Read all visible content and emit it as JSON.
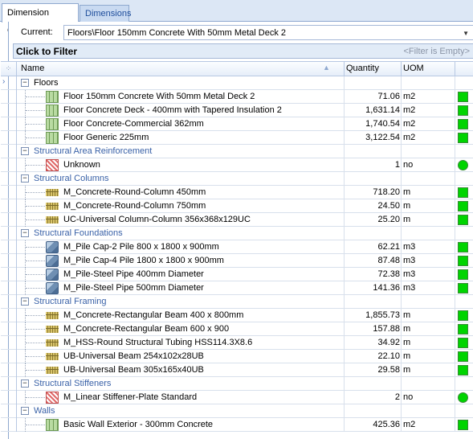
{
  "tabs": [
    "Dimension Groups",
    "Dimensions"
  ],
  "current": {
    "label": "Current:",
    "value": "Floors\\Floor 150mm Concrete With 50mm Metal Deck 2"
  },
  "filter": {
    "title": "Click to Filter",
    "empty_text": "<Filter is Empty>"
  },
  "columns": {
    "name": "Name",
    "quantity": "Quantity",
    "uom": "UOM"
  },
  "colors": {
    "status_green": "#00d400",
    "group_text": "#3a62a8",
    "tab_bg": "#dce7f5"
  },
  "rows": [
    {
      "type": "group",
      "label": "Floors",
      "first": true
    },
    {
      "type": "item",
      "icon": "floor-grid-icon",
      "name": "Floor 150mm Concrete With 50mm Metal Deck 2",
      "qty": "71.06",
      "uom": "m2",
      "status": "square"
    },
    {
      "type": "item",
      "icon": "floor-grid-icon",
      "name": "Floor Concrete Deck - 400mm with Tapered Insulation 2",
      "qty": "1,631.14",
      "uom": "m2",
      "status": "square"
    },
    {
      "type": "item",
      "icon": "floor-grid-icon",
      "name": "Floor Concrete-Commercial 362mm",
      "qty": "1,740.54",
      "uom": "m2",
      "status": "square"
    },
    {
      "type": "item",
      "icon": "floor-grid-icon",
      "name": "Floor Generic 225mm",
      "qty": "3,122.54",
      "uom": "m2",
      "status": "square"
    },
    {
      "type": "group",
      "label": "Structural Area Reinforcement"
    },
    {
      "type": "item",
      "icon": "rebar-icon",
      "name": "Unknown",
      "qty": "1",
      "uom": "no",
      "status": "circle"
    },
    {
      "type": "group",
      "label": "Structural Columns"
    },
    {
      "type": "item",
      "icon": "beam-icon",
      "name": "M_Concrete-Round-Column 450mm",
      "qty": "718.20",
      "uom": "m",
      "status": "square"
    },
    {
      "type": "item",
      "icon": "beam-icon",
      "name": "M_Concrete-Round-Column 750mm",
      "qty": "24.50",
      "uom": "m",
      "status": "square"
    },
    {
      "type": "item",
      "icon": "beam-icon",
      "name": "UC-Universal Column-Column 356x368x129UC",
      "qty": "25.20",
      "uom": "m",
      "status": "square"
    },
    {
      "type": "group",
      "label": "Structural Foundations"
    },
    {
      "type": "item",
      "icon": "cube-icon",
      "name": "M_Pile Cap-2 Pile 800 x 1800 x 900mm",
      "qty": "62.21",
      "uom": "m3",
      "status": "square"
    },
    {
      "type": "item",
      "icon": "cube-icon",
      "name": "M_Pile Cap-4 Pile 1800 x 1800 x 900mm",
      "qty": "87.48",
      "uom": "m3",
      "status": "square"
    },
    {
      "type": "item",
      "icon": "cube-icon",
      "name": "M_Pile-Steel Pipe 400mm Diameter",
      "qty": "72.38",
      "uom": "m3",
      "status": "square"
    },
    {
      "type": "item",
      "icon": "cube-icon",
      "name": "M_Pile-Steel Pipe 500mm Diameter",
      "qty": "141.36",
      "uom": "m3",
      "status": "square"
    },
    {
      "type": "group",
      "label": "Structural Framing"
    },
    {
      "type": "item",
      "icon": "beam-icon",
      "name": "M_Concrete-Rectangular Beam 400 x 800mm",
      "qty": "1,855.73",
      "uom": "m",
      "status": "square"
    },
    {
      "type": "item",
      "icon": "beam-icon",
      "name": "M_Concrete-Rectangular Beam 600 x 900",
      "qty": "157.88",
      "uom": "m",
      "status": "square"
    },
    {
      "type": "item",
      "icon": "beam-icon",
      "name": "M_HSS-Round Structural Tubing HSS114.3X8.6",
      "qty": "34.92",
      "uom": "m",
      "status": "square"
    },
    {
      "type": "item",
      "icon": "beam-icon",
      "name": "UB-Universal Beam 254x102x28UB",
      "qty": "22.10",
      "uom": "m",
      "status": "square"
    },
    {
      "type": "item",
      "icon": "beam-icon",
      "name": "UB-Universal Beam 305x165x40UB",
      "qty": "29.58",
      "uom": "m",
      "status": "square"
    },
    {
      "type": "group",
      "label": "Structural Stiffeners"
    },
    {
      "type": "item",
      "icon": "rebar-icon",
      "name": "M_Linear Stiffener-Plate Standard",
      "qty": "2",
      "uom": "no",
      "status": "circle"
    },
    {
      "type": "group",
      "label": "Walls"
    },
    {
      "type": "item",
      "icon": "floor-grid-icon",
      "name": "Basic Wall Exterior - 300mm Concrete",
      "qty": "425.36",
      "uom": "m2",
      "status": "square"
    }
  ]
}
